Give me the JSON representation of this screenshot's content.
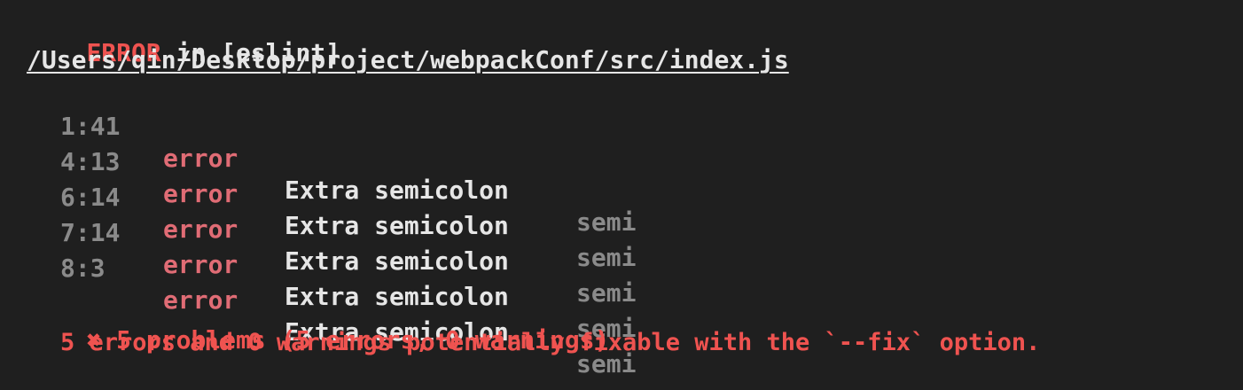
{
  "header": {
    "error_label": "ERROR",
    "in_text": " in [eslint]"
  },
  "file_path": "/Users/qin/Desktop/project/webpackConf/src/index.js",
  "problems": [
    {
      "position": "1:41",
      "severity": "error",
      "message": "Extra semicolon",
      "rule": "semi"
    },
    {
      "position": "4:13",
      "severity": "error",
      "message": "Extra semicolon",
      "rule": "semi"
    },
    {
      "position": "6:14",
      "severity": "error",
      "message": "Extra semicolon",
      "rule": "semi"
    },
    {
      "position": "7:14",
      "severity": "error",
      "message": "Extra semicolon",
      "rule": "semi"
    },
    {
      "position": "8:3",
      "severity": "error",
      "message": "Extra semicolon",
      "rule": "semi"
    }
  ],
  "summary": {
    "icon": "✖",
    "problems_text": "5 problems (5 errors, 0 warnings)",
    "fixable_text": "5 errors and 0 warnings potentially fixable with the `--fix` option."
  },
  "colors": {
    "background": "#1f1f1f",
    "error_red": "#ef5350",
    "severity_red": "#e06c75",
    "text_white": "#e6e6e6",
    "dim_gray": "#8a8a8a"
  }
}
